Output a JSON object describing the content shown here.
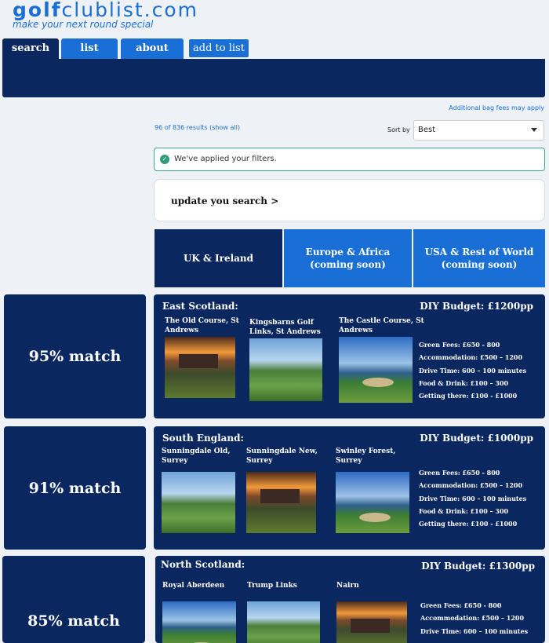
{
  "logo": {
    "bold": "golf",
    "rest": "clublist.com",
    "tagline": "make your next round special"
  },
  "tabs": {
    "search": "search",
    "list": "list",
    "about": "about",
    "add": "add to list"
  },
  "notice": {
    "bag_fees": "Additional bag fees may apply"
  },
  "results": {
    "count": "96 of 836 results (show all)",
    "sort_label": "Sort by",
    "sort_value": "Best"
  },
  "filters": {
    "message": "We've applied your filters."
  },
  "update": {
    "label": "update you search >"
  },
  "regions": [
    {
      "label": "UK & Ireland"
    },
    {
      "label": "Europe & Africa\n(coming soon)"
    },
    {
      "label": "USA & Rest of World\n(coming soon)"
    }
  ],
  "cards": [
    {
      "match": "95% match",
      "region": "East Scotland:",
      "budget": "DIY Budget: £1200pp",
      "courses": [
        {
          "name": "The Old Course, St Andrews",
          "photo": "castle"
        },
        {
          "name": "Kingsbarns Golf Links, St Andrews",
          "photo": "links"
        },
        {
          "name": "The Castle Course, St Andrews",
          "photo": "dunes"
        }
      ],
      "stats": [
        "Green Fees:  £650 - 800",
        "Accommodation: £500 – 1200",
        "Drive Time: 600 – 100 minutes",
        "Food & Drink: £100 – 300",
        "Getting there: £100 - £1000"
      ]
    },
    {
      "match": "91% match",
      "region": "South England:",
      "budget": "DIY Budget: £1000pp",
      "courses": [
        {
          "name": "Sunningdale Old, Surrey",
          "photo": "links"
        },
        {
          "name": "Sunningdale New, Surrey",
          "photo": "castle"
        },
        {
          "name": "Swinley Forest, Surrey",
          "photo": "dunes"
        }
      ],
      "stats": [
        "Green Fees:  £650 - 800",
        "Accommodation: £500 – 1200",
        "Drive Time: 600 – 100 minutes",
        "Food & Drink: £100 – 300",
        "Getting there: £100 - £1000"
      ]
    },
    {
      "match": "85% match",
      "region": "North Scotland:",
      "budget": "DIY Budget: £1300pp",
      "courses": [
        {
          "name": "Royal Aberdeen",
          "photo": "dunes"
        },
        {
          "name": "Trump Links",
          "photo": "links"
        },
        {
          "name": "Nairn",
          "photo": "castle"
        }
      ],
      "stats": [
        "Green Fees:  £650 - 800",
        "Accommodation: £500 – 1200",
        "Drive Time: 600 – 100 minutes"
      ]
    }
  ],
  "colors": {
    "navy": "#0a2760",
    "blue": "#1a6fd6",
    "success": "#2f9d7a",
    "background": "#eef1f6"
  }
}
